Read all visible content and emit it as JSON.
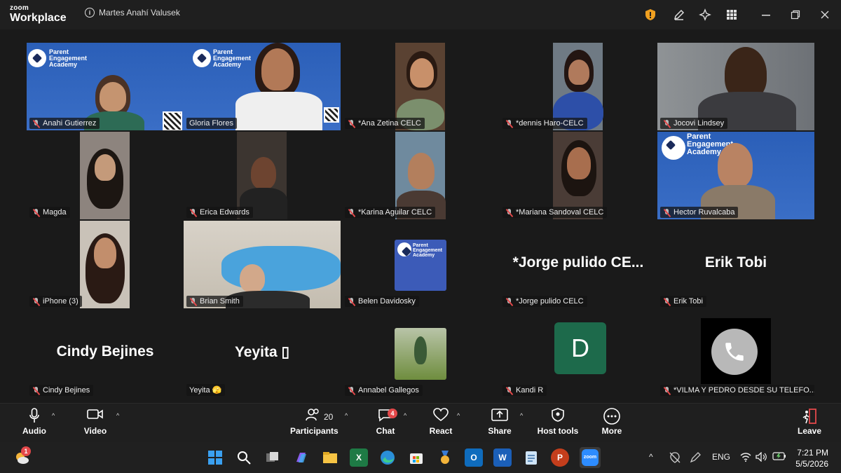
{
  "app": {
    "logo_line1": "zoom",
    "logo_line2": "Workplace",
    "meeting_info": "Martes Anahí Valusek"
  },
  "tiles": [
    {
      "name": "Anahi Gutierrez",
      "big": ""
    },
    {
      "name": "Gloria Flores",
      "big": ""
    },
    {
      "name": "*Ana Zetina CELC",
      "big": ""
    },
    {
      "name": "*dennis Haro-CELC",
      "big": ""
    },
    {
      "name": "Jocovi Lindsey",
      "big": ""
    },
    {
      "name": "Magda",
      "big": ""
    },
    {
      "name": "Erica Edwards",
      "big": ""
    },
    {
      "name": "*Karina Aguilar CELC",
      "big": ""
    },
    {
      "name": "*Mariana Sandoval CELC",
      "big": ""
    },
    {
      "name": "Hector Ruvalcaba",
      "big": ""
    },
    {
      "name": "iPhone (3)",
      "big": ""
    },
    {
      "name": "Brian Smith",
      "big": ""
    },
    {
      "name": "Belen Davidosky",
      "big": ""
    },
    {
      "name": "*Jorge pulido CELC",
      "big": "*Jorge pulido CE..."
    },
    {
      "name": "Erik Tobi",
      "big": "Erik Tobi"
    },
    {
      "name": "Cindy Bejines",
      "big": "Cindy Bejines"
    },
    {
      "name": "Yeyita 🫣",
      "big": "Yeyita ▯"
    },
    {
      "name": "Annabel Gallegos",
      "big": ""
    },
    {
      "name": "Kandi R",
      "big": "",
      "avatar": "D"
    },
    {
      "name": "*VILMA Y PEDRO DESDE SU TELEFO...",
      "big": ""
    }
  ],
  "pea": {
    "line1": "Parent",
    "line2": "Engagement",
    "line3": "Academy"
  },
  "controls": {
    "audio": "Audio",
    "video": "Video",
    "participants": "Participants",
    "participants_count": "20",
    "chat": "Chat",
    "chat_badge": "4",
    "react": "React",
    "share": "Share",
    "host_tools": "Host tools",
    "more": "More",
    "leave": "Leave"
  },
  "taskbar": {
    "weather_badge": "1",
    "lang": "ENG",
    "time": "7:21 PM",
    "date": "5/5/2026"
  },
  "colors": {
    "active_speaker": "#39d39b",
    "mute": "#e3484a",
    "leave": "#e3484a",
    "pea_blue": "#2b5fb8"
  }
}
